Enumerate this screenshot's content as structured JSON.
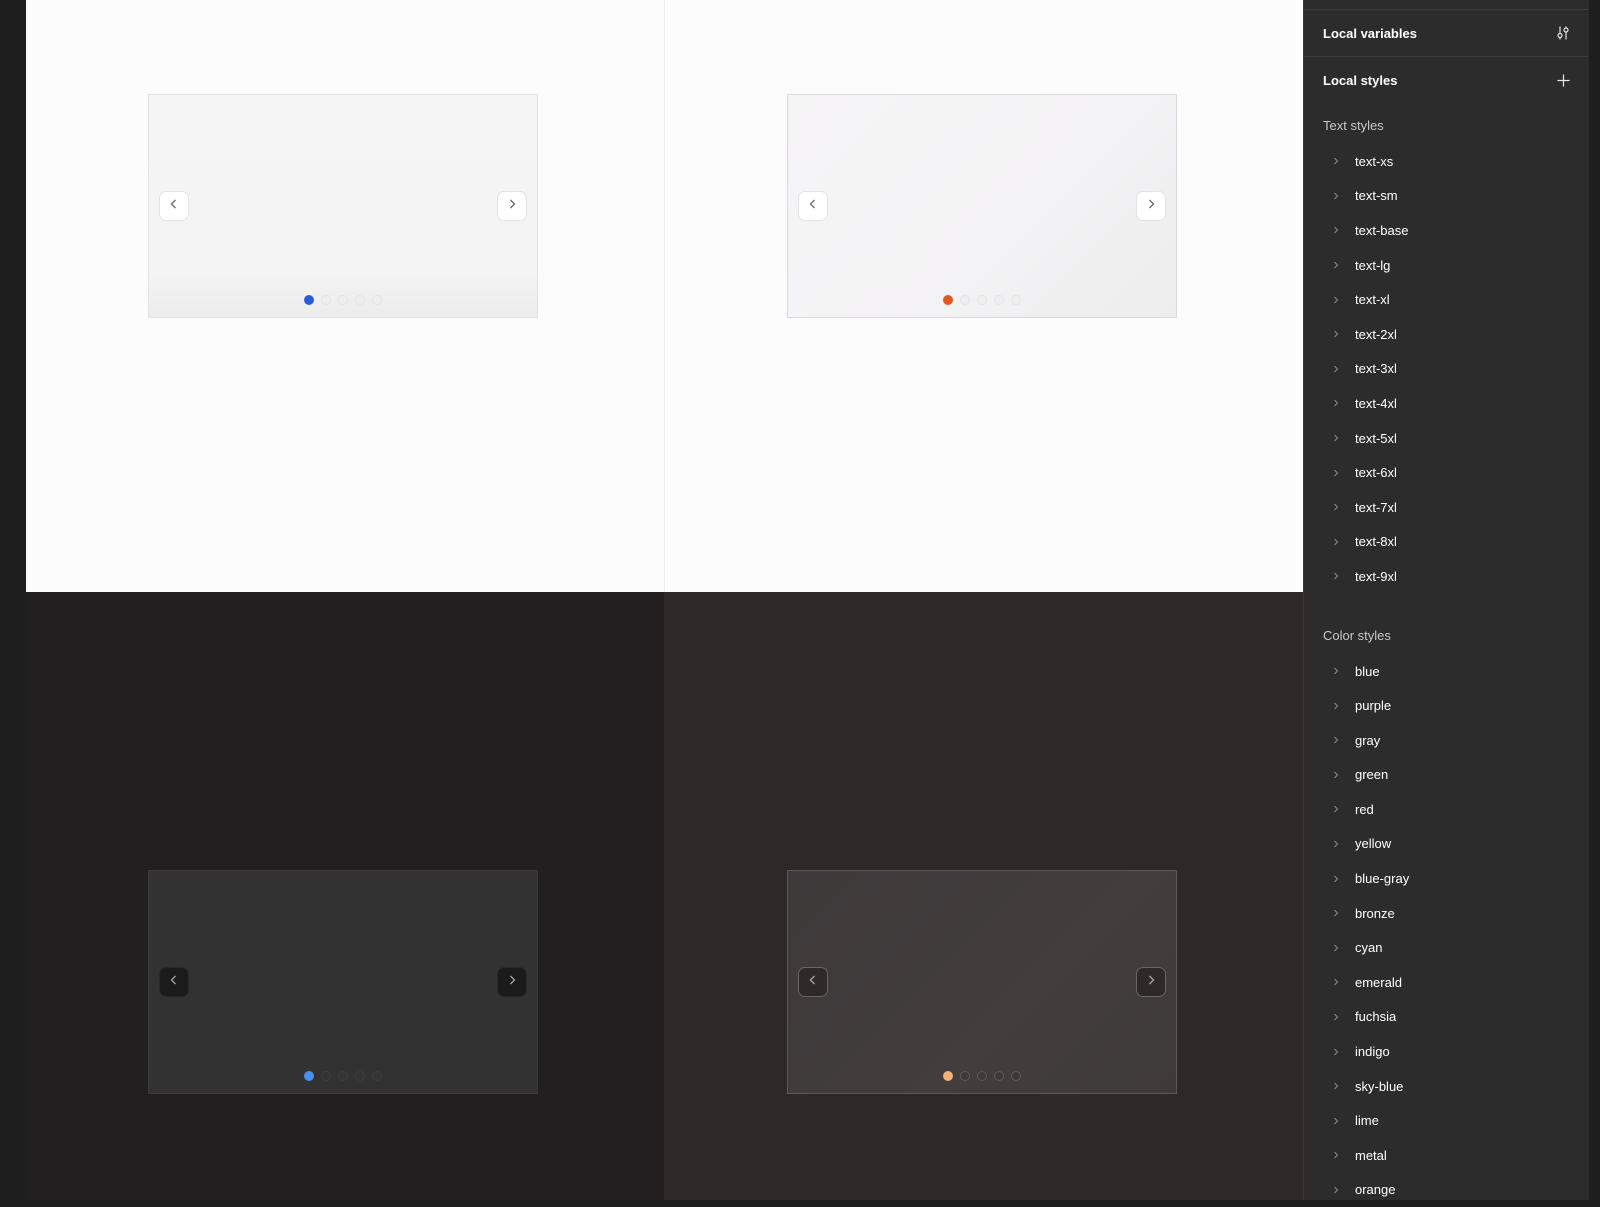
{
  "canvas": {
    "frames": [
      {
        "theme": "light",
        "active_dot_color": "#2a5bd7",
        "dot_count": 5,
        "active_index": 0,
        "prev_icon": "chevron-left-icon",
        "next_icon": "chevron-right-icon"
      },
      {
        "theme": "light",
        "active_dot_color": "#e25822",
        "dot_count": 5,
        "active_index": 0,
        "prev_icon": "chevron-left-icon",
        "next_icon": "chevron-right-icon"
      },
      {
        "theme": "dark",
        "active_dot_color": "#4a90f0",
        "dot_count": 5,
        "active_index": 0,
        "prev_icon": "chevron-left-icon",
        "next_icon": "chevron-right-icon"
      },
      {
        "theme": "dark",
        "active_dot_color": "#f2b27a",
        "dot_count": 5,
        "active_index": 0,
        "prev_icon": "chevron-left-icon",
        "next_icon": "chevron-right-icon"
      }
    ]
  },
  "panel": {
    "local_variables": {
      "label": "Local variables",
      "icon": "adjust-sliders-icon"
    },
    "local_styles": {
      "label": "Local styles",
      "icon": "plus-icon"
    },
    "text_styles": {
      "heading": "Text styles",
      "items": [
        "text-xs",
        "text-sm",
        "text-base",
        "text-lg",
        "text-xl",
        "text-2xl",
        "text-3xl",
        "text-4xl",
        "text-5xl",
        "text-6xl",
        "text-7xl",
        "text-8xl",
        "text-9xl"
      ]
    },
    "color_styles": {
      "heading": "Color styles",
      "items": [
        "blue",
        "purple",
        "gray",
        "green",
        "red",
        "yellow",
        "blue-gray",
        "bronze",
        "cyan",
        "emerald",
        "fuchsia",
        "indigo",
        "sky-blue",
        "lime",
        "metal",
        "orange"
      ]
    }
  }
}
